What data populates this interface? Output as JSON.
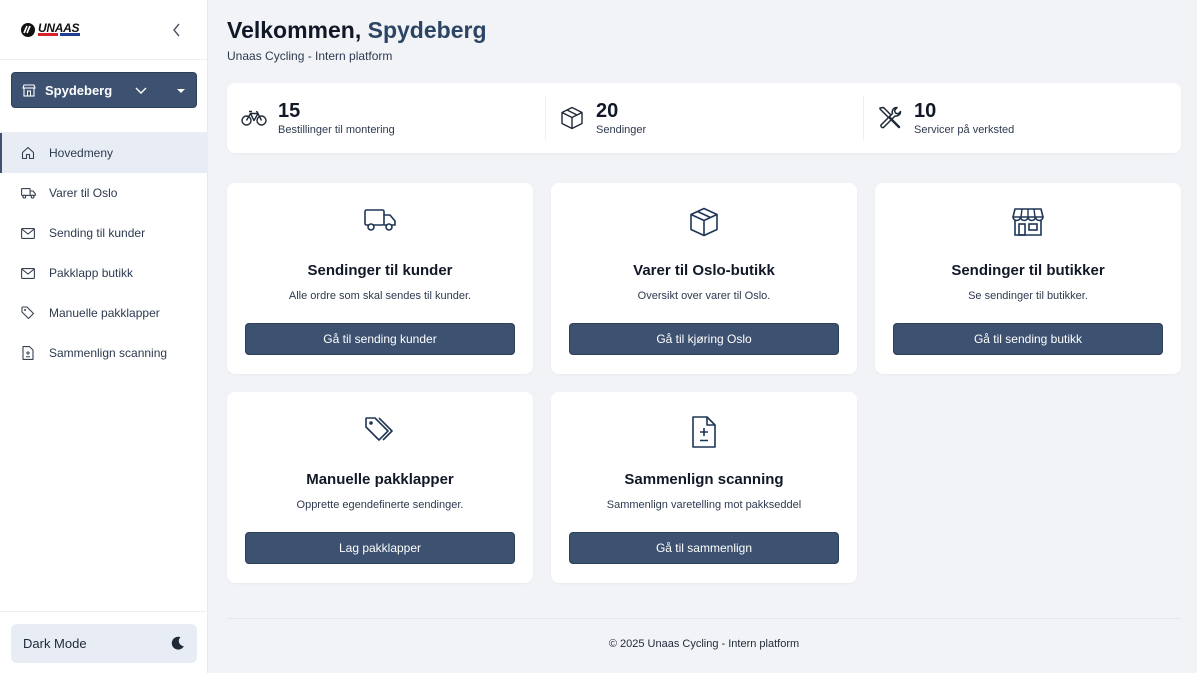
{
  "brand": {
    "logo_text": "UNAAS"
  },
  "sidebar": {
    "store_select": {
      "value": "Spydeberg"
    },
    "items": [
      {
        "label": "Hovedmeny",
        "icon": "home-icon"
      },
      {
        "label": "Varer til Oslo",
        "icon": "truck-icon"
      },
      {
        "label": "Sending til kunder",
        "icon": "mail-icon"
      },
      {
        "label": "Pakklapp butikk",
        "icon": "mail-icon"
      },
      {
        "label": "Manuelle pakklapper",
        "icon": "tag-icon"
      },
      {
        "label": "Sammenlign scanning",
        "icon": "file-diff-icon"
      }
    ],
    "dark_mode_label": "Dark Mode"
  },
  "header": {
    "welcome_prefix": "Velkommen,",
    "store_name": "Spydeberg",
    "subtitle": "Unaas Cycling - Intern platform"
  },
  "stats": [
    {
      "value": "15",
      "label": "Bestillinger til montering",
      "icon": "bike-icon"
    },
    {
      "value": "20",
      "label": "Sendinger",
      "icon": "box-icon"
    },
    {
      "value": "10",
      "label": "Servicer på verksted",
      "icon": "tools-icon"
    }
  ],
  "cards": [
    {
      "title": "Sendinger til kunder",
      "desc": "Alle ordre som skal sendes til kunder.",
      "button": "Gå til sending kunder",
      "icon": "truck-icon"
    },
    {
      "title": "Varer til Oslo-butikk",
      "desc": "Oversikt over varer til Oslo.",
      "button": "Gå til kjøring Oslo",
      "icon": "box-icon"
    },
    {
      "title": "Sendinger til butikker",
      "desc": "Se sendinger til butikker.",
      "button": "Gå til sending butikk",
      "icon": "store-icon"
    },
    {
      "title": "Manuelle pakklapper",
      "desc": "Opprette egendefinerte sendinger.",
      "button": "Lag pakklapper",
      "icon": "tag-icon"
    },
    {
      "title": "Sammenlign scanning",
      "desc": "Sammenlign varetelling mot pakkseddel",
      "button": "Gå til sammenlign",
      "icon": "file-diff-icon"
    }
  ],
  "footer": {
    "text": "© 2025 Unaas Cycling - Intern platform"
  },
  "colors": {
    "primary": "#3d5170",
    "accent_text": "#2c4565",
    "background": "#f1f3f7"
  }
}
